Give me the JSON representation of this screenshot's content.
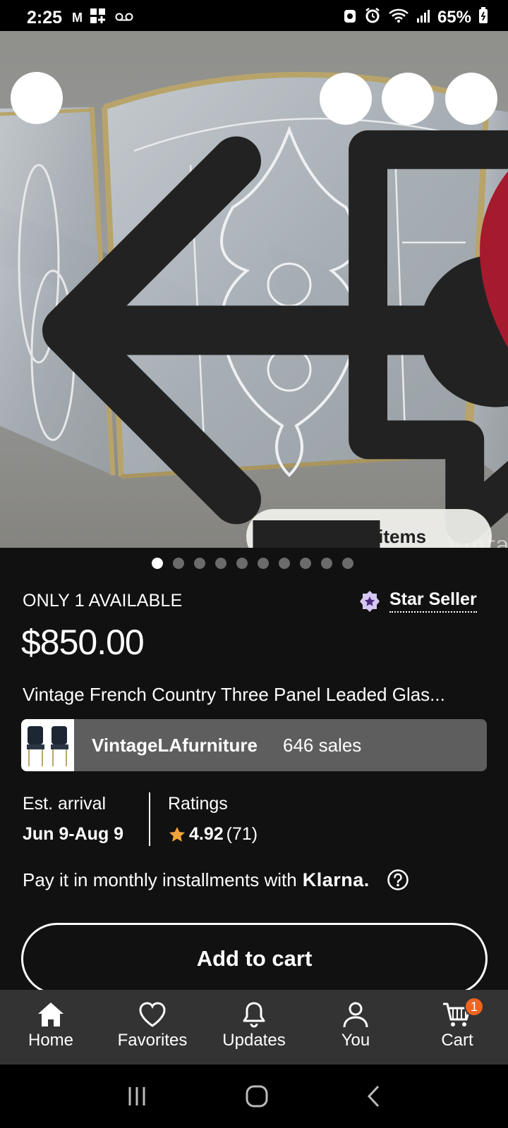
{
  "status_bar": {
    "time": "2:25",
    "left_icons": [
      "gmail-icon",
      "apps-icon",
      "voicemail-icon"
    ],
    "battery": "65%"
  },
  "hero": {
    "photo_watermark": "Vintage L",
    "find_similar_label": "Find similar items",
    "image_count": 10,
    "active_image_index": 0
  },
  "listing": {
    "availability": "ONLY 1 AVAILABLE",
    "star_seller_label": "Star Seller",
    "price": "$850.00",
    "title": "Vintage French Country Three Panel Leaded Glas..."
  },
  "shop": {
    "name": "VintageLAfurniture",
    "sales": "646 sales"
  },
  "delivery": {
    "label": "Est. arrival",
    "value": "Jun 9-Aug 9"
  },
  "ratings": {
    "label": "Ratings",
    "score": "4.92",
    "count": "(71)"
  },
  "klarna": {
    "text": "Pay it in monthly installments with",
    "brand": "Klarna."
  },
  "actions": {
    "add_to_cart": "Add to cart"
  },
  "bottom_nav": {
    "items": [
      {
        "label": "Home",
        "icon": "home-icon"
      },
      {
        "label": "Favorites",
        "icon": "heart-icon"
      },
      {
        "label": "Updates",
        "icon": "bell-icon"
      },
      {
        "label": "You",
        "icon": "person-icon"
      },
      {
        "label": "Cart",
        "icon": "cart-icon"
      }
    ],
    "cart_badge": "1"
  },
  "colors": {
    "background": "#111111",
    "favorite_heart": "#a61a2e",
    "rating_star": "#f0a23b",
    "cart_badge": "#f1641e",
    "nav_background": "#333333"
  }
}
